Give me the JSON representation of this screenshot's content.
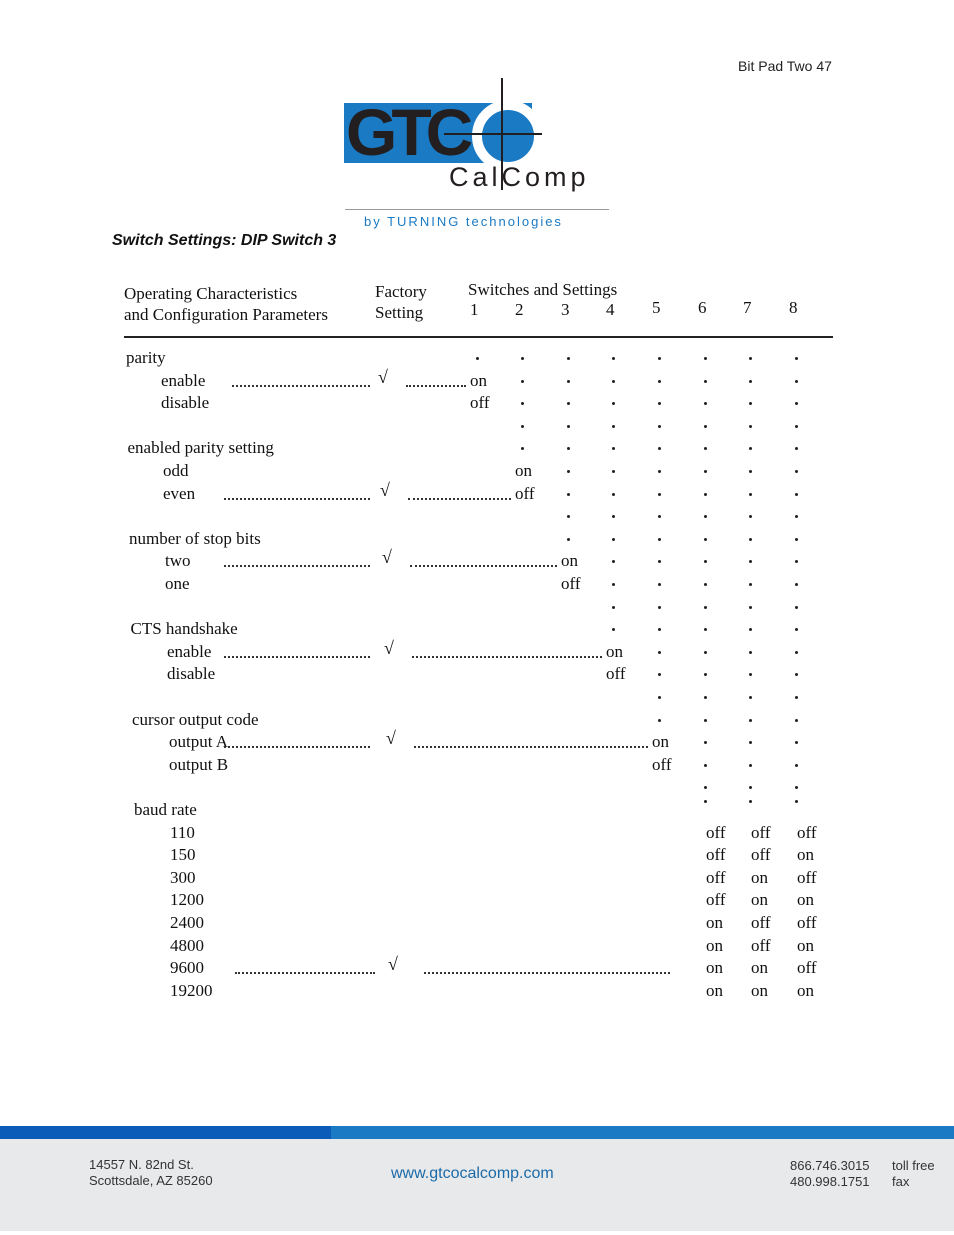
{
  "page_header": "Bit Pad Two 47",
  "logo": {
    "main": "GTC",
    "sub": "CalComp",
    "tagline": "by TURNING technologies",
    "accent_color": "#1a7ac4"
  },
  "section_title": "Switch Settings: DIP Switch 3",
  "table": {
    "header": {
      "col1_line1": "Operating Characteristics",
      "col1_line2": "and Configuration Parameters",
      "col2_line1": "Factory",
      "col2_line2": "Setting",
      "col3_title": "Switches and Settings",
      "switch_numbers": [
        "1",
        "2",
        "3",
        "4",
        "5",
        "6",
        "7",
        "8"
      ]
    },
    "groups": [
      {
        "title": "parity",
        "options": [
          {
            "label": "enable",
            "factory": "√",
            "switch": 1,
            "value": "on"
          },
          {
            "label": "disable",
            "factory": "",
            "switch": 1,
            "value": "off"
          }
        ]
      },
      {
        "title": "enabled parity setting",
        "options": [
          {
            "label": "odd",
            "factory": "",
            "switch": 2,
            "value": "on"
          },
          {
            "label": "even",
            "factory": "√",
            "switch": 2,
            "value": "off"
          }
        ]
      },
      {
        "title": "number of stop bits",
        "options": [
          {
            "label": "two",
            "factory": "√",
            "switch": 3,
            "value": "on"
          },
          {
            "label": "one",
            "factory": "",
            "switch": 3,
            "value": "off"
          }
        ]
      },
      {
        "title": "CTS handshake",
        "options": [
          {
            "label": "enable",
            "factory": "√",
            "switch": 4,
            "value": "on"
          },
          {
            "label": "disable",
            "factory": "",
            "switch": 4,
            "value": "off"
          }
        ]
      },
      {
        "title": "cursor output code",
        "options": [
          {
            "label": "output  A",
            "factory": "√",
            "switch": 5,
            "value": "on"
          },
          {
            "label": "output B",
            "factory": "",
            "switch": 5,
            "value": "off"
          }
        ]
      }
    ],
    "baud": {
      "title": "baud rate",
      "rows": [
        {
          "label": "110",
          "factory": "",
          "s6": "off",
          "s7": "off",
          "s8": "off"
        },
        {
          "label": "150",
          "factory": "",
          "s6": "off",
          "s7": "off",
          "s8": "on"
        },
        {
          "label": "300",
          "factory": "",
          "s6": "off",
          "s7": "on",
          "s8": "off"
        },
        {
          "label": "1200",
          "factory": "",
          "s6": "off",
          "s7": "on",
          "s8": "on"
        },
        {
          "label": "2400",
          "factory": "",
          "s6": "on",
          "s7": "off",
          "s8": "off"
        },
        {
          "label": "4800",
          "factory": "",
          "s6": "on",
          "s7": "off",
          "s8": "on"
        },
        {
          "label": "9600",
          "factory": "√",
          "s6": "on",
          "s7": "on",
          "s8": "off"
        },
        {
          "label": "19200",
          "factory": "",
          "s6": "on",
          "s7": "on",
          "s8": "on"
        }
      ]
    }
  },
  "footer": {
    "address_line1": "14557 N. 82nd St.",
    "address_line2": "Scottsdale, AZ 85260",
    "website": "www.gtcocalcomp.com",
    "phone1": "866.746.3015",
    "phone1_label": "toll free",
    "phone2": "480.998.1751",
    "phone2_label": "fax",
    "bar_colors": [
      "#0a5cb8",
      "#1a7ac4"
    ]
  }
}
